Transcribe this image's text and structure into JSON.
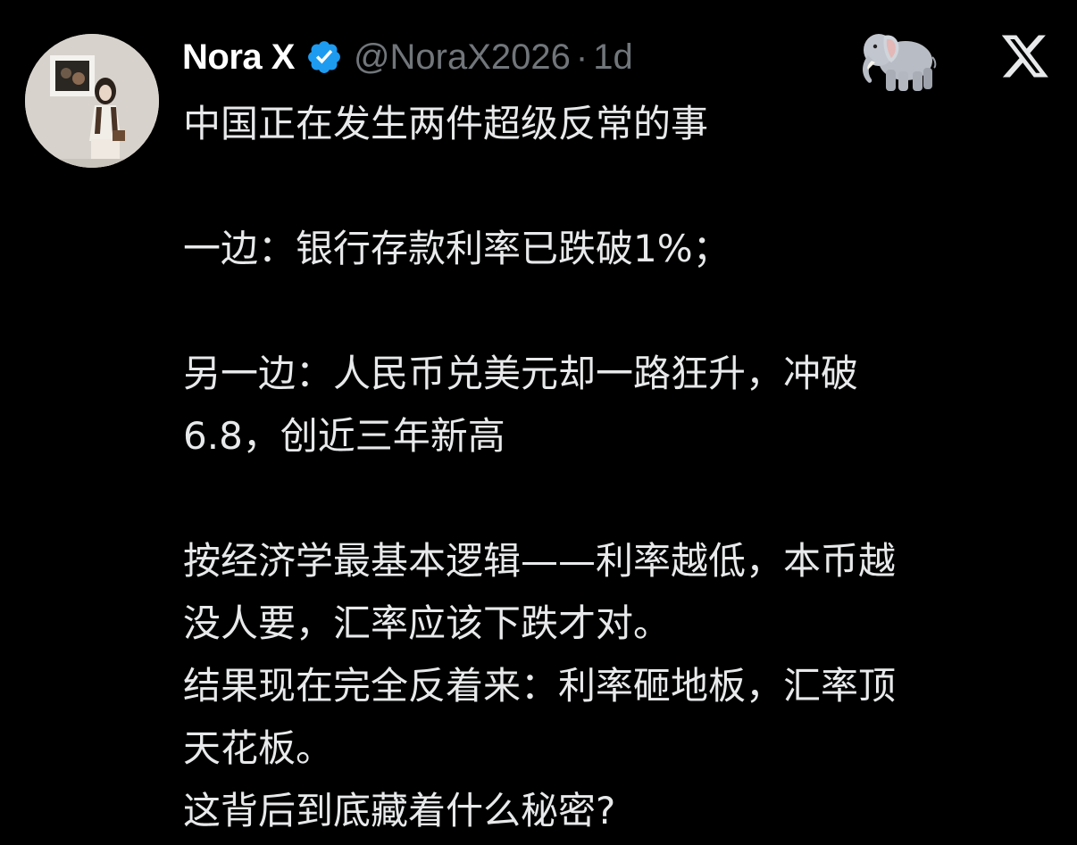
{
  "tweet": {
    "author_name": "Nora X",
    "handle": "@NoraX2026",
    "separator": "·",
    "time": "1d",
    "verified": true,
    "accent_color": "#1d9bf0",
    "avatar_icon": "user-photo-avatar",
    "emoji_icon": "elephant-icon",
    "platform_icon": "x-logo-icon",
    "lines": [
      "中国正在发生两件超级反常的事",
      "",
      "一边：银行存款利率已跌破1%；",
      "",
      "另一边：人民币兑美元却一路狂升，冲破",
      "6.8，创近三年新高",
      "",
      "按经济学最基本逻辑——利率越低，本币越",
      "没人要，汇率应该下跌才对。",
      "结果现在完全反着来：利率砸地板，汇率顶",
      "天花板。",
      "这背后到底藏着什么秘密?"
    ]
  }
}
